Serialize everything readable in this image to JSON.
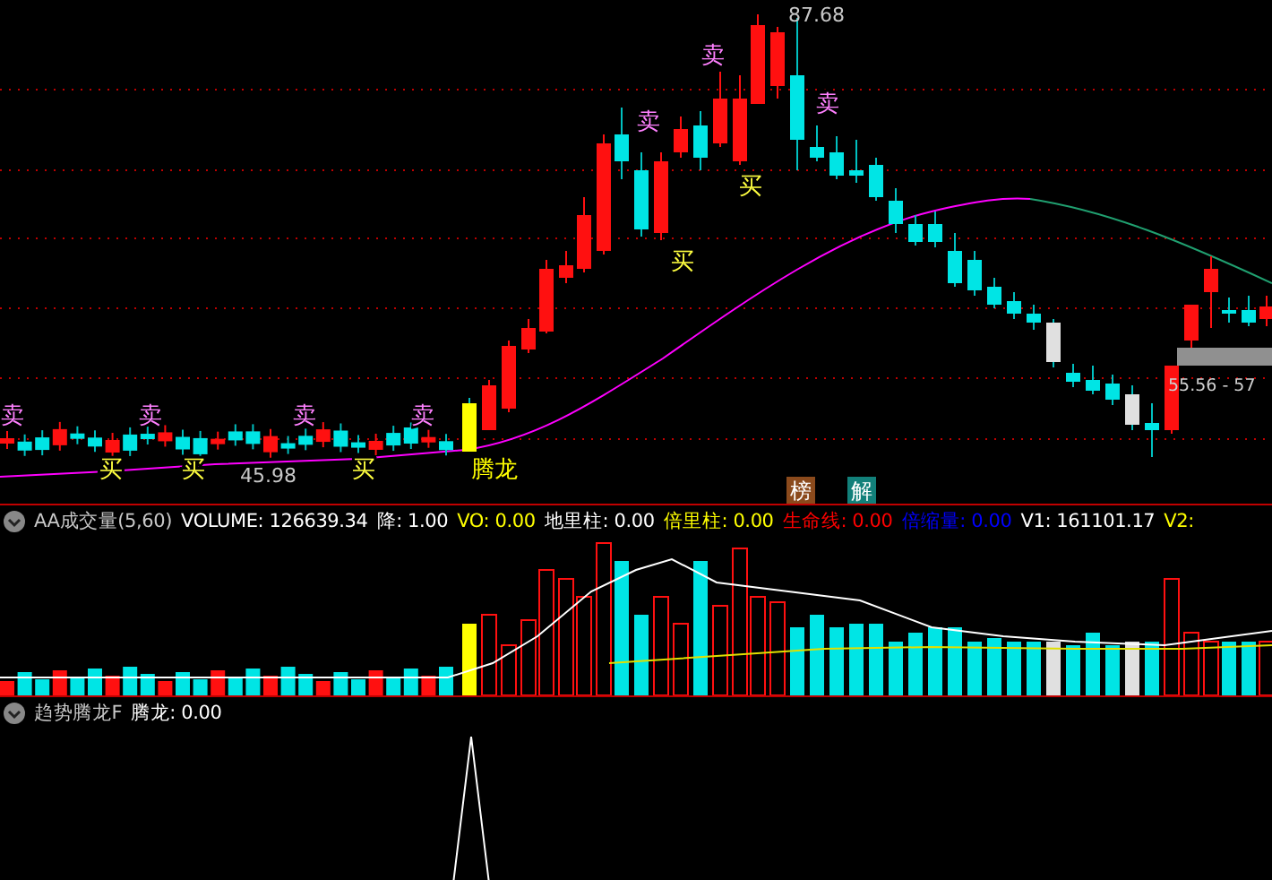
{
  "price_chart": {
    "high_label": "87.68",
    "low_label": "45.98",
    "range_label": "55.56 - 57",
    "signals": [
      {
        "kind": "sell",
        "text": "卖"
      },
      {
        "kind": "buy",
        "text": "买"
      },
      {
        "kind": "sell",
        "text": "卖"
      },
      {
        "kind": "buy",
        "text": "买"
      },
      {
        "kind": "sell",
        "text": "卖"
      },
      {
        "kind": "buy",
        "text": "买"
      },
      {
        "kind": "sell",
        "text": "卖"
      },
      {
        "kind": "dragon",
        "text": "腾龙"
      },
      {
        "kind": "sell",
        "text": "卖"
      },
      {
        "kind": "buy",
        "text": "买"
      },
      {
        "kind": "sell",
        "text": "卖"
      },
      {
        "kind": "buy",
        "text": "买"
      },
      {
        "kind": "sell",
        "text": "卖"
      }
    ],
    "badges": [
      {
        "text": "榜",
        "color": "#8b4a1c"
      },
      {
        "text": "解",
        "color": "#12807a"
      }
    ]
  },
  "volume_panel": {
    "title": "AA成交量(5,60)",
    "indicators": [
      {
        "label": "VOLUME: 126639.34",
        "color": "#ffffff"
      },
      {
        "label": "降: 1.00",
        "color": "#ffffff"
      },
      {
        "label": "VO: 0.00",
        "color": "#ffff00"
      },
      {
        "label": "地里柱: 0.00",
        "color": "#ffffff"
      },
      {
        "label": "倍里柱: 0.00",
        "color": "#ffff00"
      },
      {
        "label": "生命线: 0.00",
        "color": "#ff0000"
      },
      {
        "label": "倍缩量: 0.00",
        "color": "#0000ff"
      },
      {
        "label": "V1: 161101.17",
        "color": "#ffffff"
      },
      {
        "label": "V2:",
        "color": "#ffff00"
      }
    ]
  },
  "trend_panel": {
    "title": "趋势腾龙F",
    "indicators": [
      {
        "label": "腾龙: 0.00",
        "color": "#ffffff"
      }
    ]
  }
}
